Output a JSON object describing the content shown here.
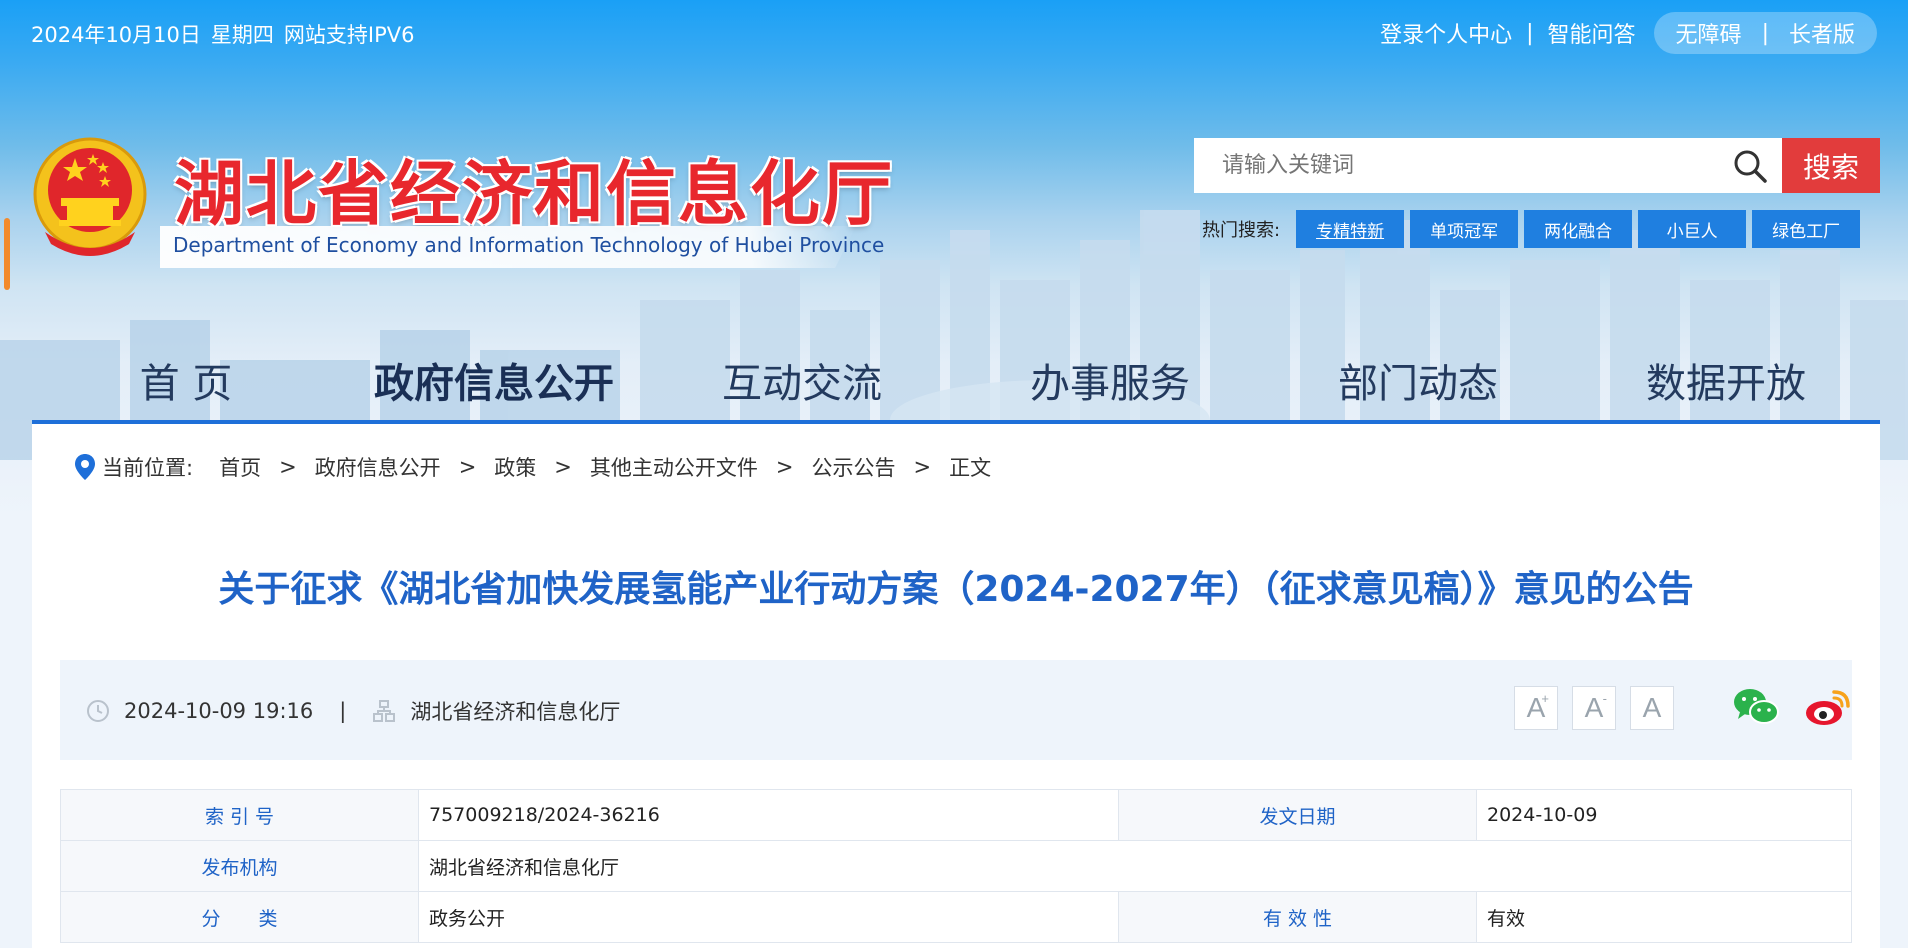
{
  "topbar": {
    "date": "2024年10月10日",
    "weekday": "星期四",
    "ipv6": "网站支持IPV6",
    "login": "登录个人中心",
    "qa": "智能问答",
    "accessibility": "无障碍",
    "elderly": "长者版",
    "separator": "|"
  },
  "logo": {
    "name_cn": "湖北省经济和信息化厅",
    "name_en": "Department of Economy and Information Technology of Hubei Province"
  },
  "search": {
    "placeholder": "请输入关键词",
    "button": "搜索",
    "hot_label": "热门搜索:",
    "hot_tags": [
      "专精特新",
      "单项冠军",
      "两化融合",
      "小巨人",
      "绿色工厂"
    ]
  },
  "nav": {
    "items": [
      "首 页",
      "政府信息公开",
      "互动交流",
      "办事服务",
      "部门动态",
      "数据开放"
    ],
    "active_index": 1
  },
  "breadcrumb": {
    "label": "当前位置:",
    "items": [
      "首页",
      "政府信息公开",
      "政策",
      "其他主动公开文件",
      "公示公告",
      "正文"
    ],
    "separator": ">"
  },
  "article": {
    "title": "关于征求《湖北省加快发展氢能产业行动方案（2024-2027年）（征求意见稿）》意见的公告",
    "datetime": "2024-10-09 19:16",
    "source": "湖北省经济和信息化厅",
    "divider": "|"
  },
  "font_controls": {
    "large": "A",
    "large_mark": "+",
    "small": "A",
    "small_mark": "-",
    "default": "A"
  },
  "info": {
    "index_label": "索 引 号",
    "index_value": "757009218/2024-36216",
    "date_label": "发文日期",
    "date_value": "2024-10-09",
    "org_label": "发布机构",
    "org_value": "湖北省经济和信息化厅",
    "category_label": "分　　类",
    "category_value": "政务公开",
    "validity_label": "有 效 性",
    "validity_value": "有效"
  },
  "colors": {
    "accent": "#1e6fd9",
    "title_blue": "#1f63c7",
    "search_red": "#e23c3c",
    "logo_red": "#e8272d"
  }
}
